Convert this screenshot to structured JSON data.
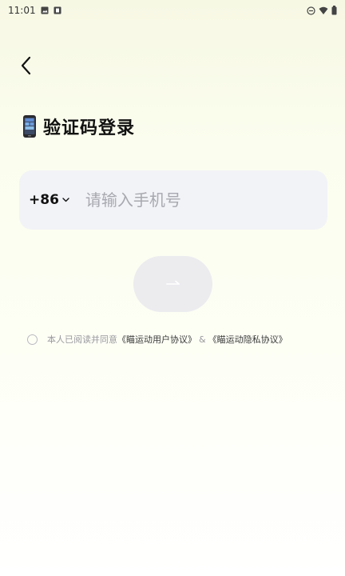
{
  "status_bar": {
    "time": "11:01",
    "left_icons": [
      "image-icon",
      "notification-icon"
    ],
    "right_icons": [
      "do-not-disturb-icon",
      "wifi-icon",
      "battery-icon"
    ]
  },
  "nav": {
    "back_icon": "chevron-left-icon"
  },
  "page": {
    "title": "验证码登录",
    "title_icon": "phone-emoji-icon"
  },
  "phone_field": {
    "country_code": "+86",
    "placeholder": "请输入手机号",
    "value": ""
  },
  "next_button": {
    "icon": "arrow-right-icon",
    "state": "disabled"
  },
  "agreement": {
    "prefix": "本人已阅读并同意",
    "user_agreement": "《瞄运动用户协议》",
    "connector": "&",
    "privacy_agreement": "《瞄运动隐私协议》",
    "checked": false
  },
  "colors": {
    "background_top": "#f7f8e4",
    "field_bg": "#f2f3f7",
    "button_bg": "#ececef",
    "placeholder": "#a8a9b0"
  }
}
